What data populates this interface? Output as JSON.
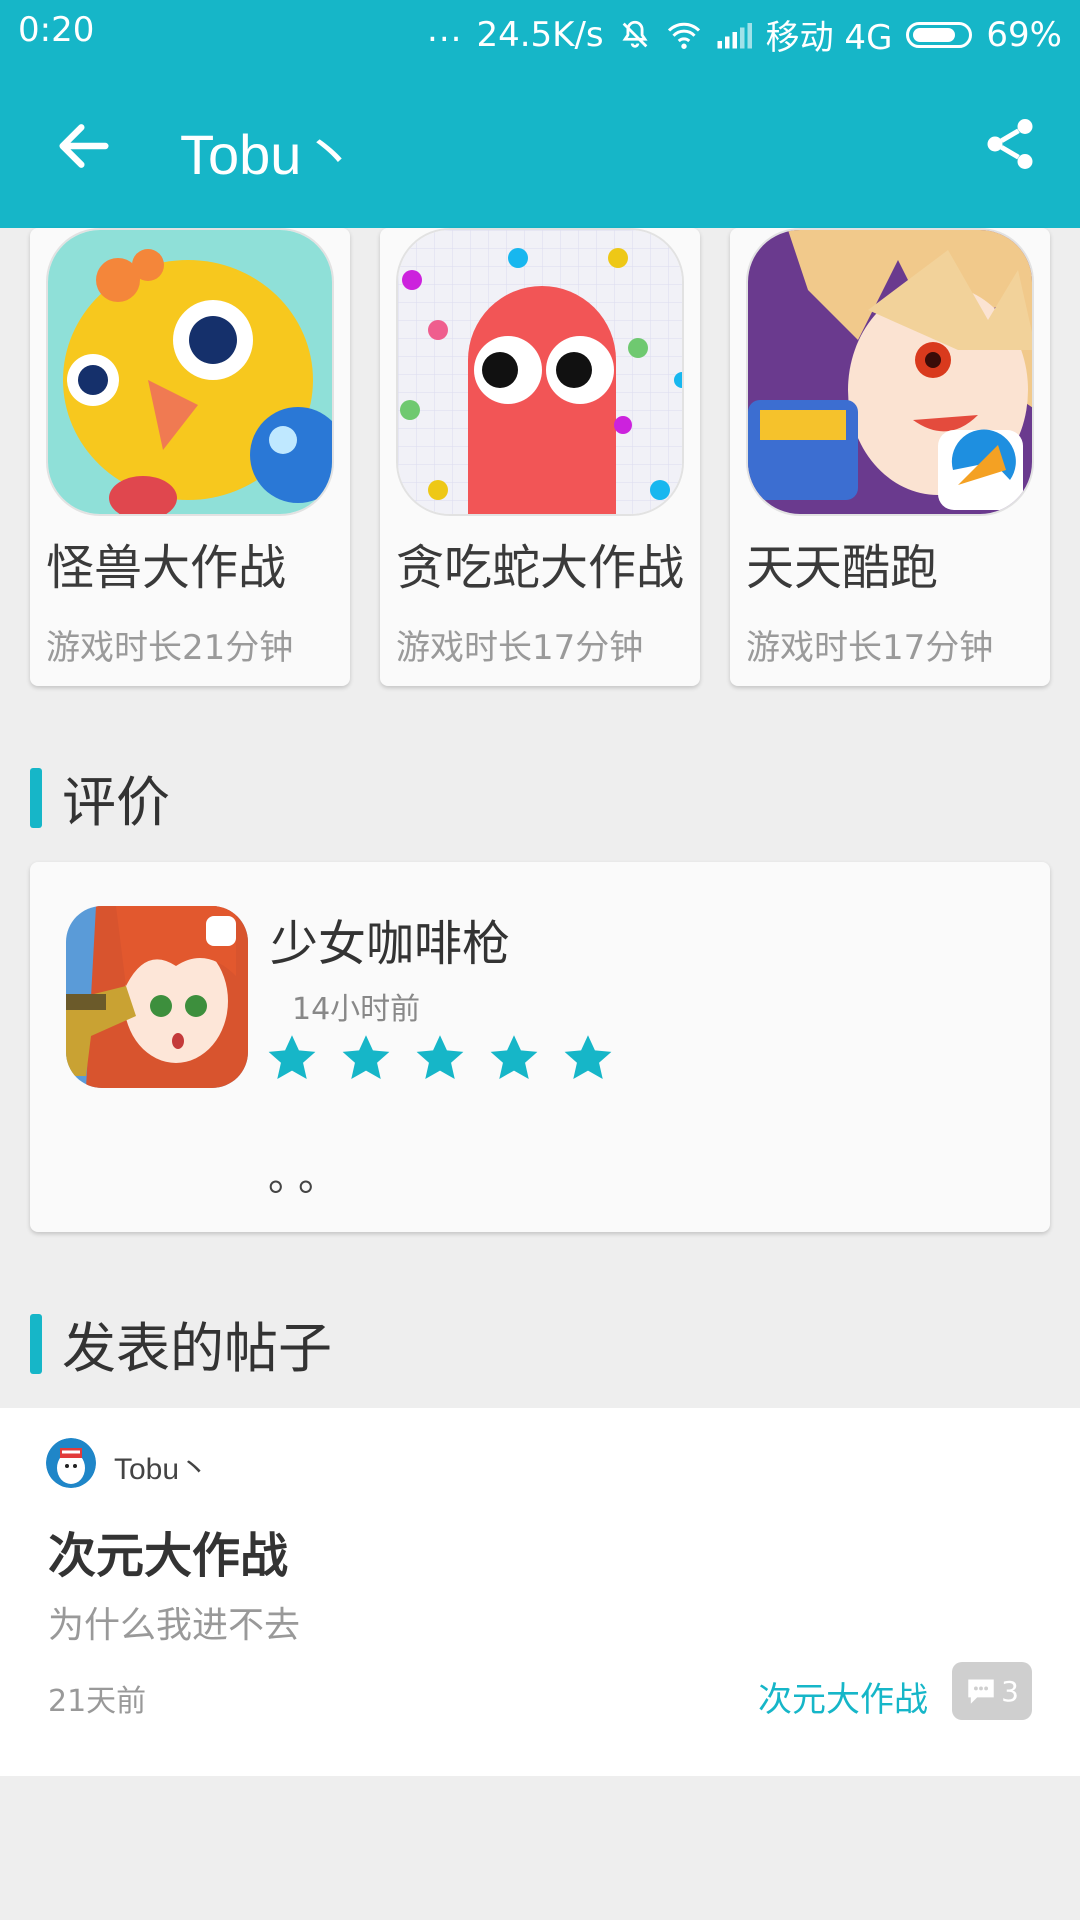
{
  "status_bar": {
    "time": "0:20",
    "dots": "...",
    "speed": "24.5K/s",
    "carrier": "移动 4G",
    "battery": "69%"
  },
  "app_bar": {
    "title": "Tobu丶",
    "back_icon": "arrow-left-icon",
    "share_icon": "share-icon"
  },
  "games": [
    {
      "name": "怪兽大作战",
      "playtime": "游戏时长21分钟"
    },
    {
      "name": "贪吃蛇大作战",
      "playtime": "游戏时长17分钟"
    },
    {
      "name": "天天酷跑",
      "playtime": "游戏时长17分钟"
    }
  ],
  "sections": {
    "reviews": "评价",
    "posts": "发表的帖子"
  },
  "review": {
    "game": "少女咖啡枪",
    "time": "14小时前",
    "rating": 5,
    "text": "。。"
  },
  "post": {
    "author": "Tobu丶",
    "title": "次元大作战",
    "body": "为什么我进不去",
    "date": "21天前",
    "tag": "次元大作战",
    "comments": "3"
  },
  "colors": {
    "accent": "#16b6c8",
    "background": "#eeeeee"
  }
}
